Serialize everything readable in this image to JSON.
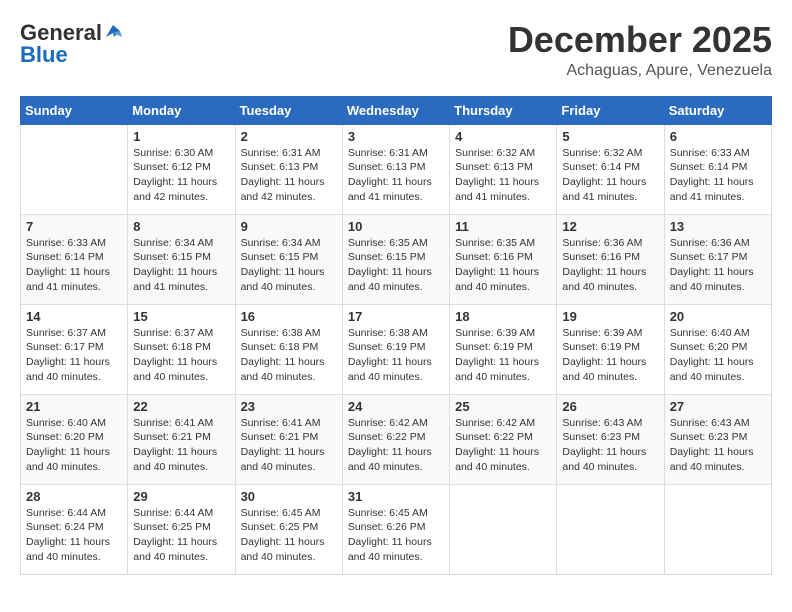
{
  "header": {
    "logo_general": "General",
    "logo_blue": "Blue",
    "title": "December 2025",
    "location": "Achaguas, Apure, Venezuela"
  },
  "calendar": {
    "days_of_week": [
      "Sunday",
      "Monday",
      "Tuesday",
      "Wednesday",
      "Thursday",
      "Friday",
      "Saturday"
    ],
    "weeks": [
      [
        {
          "day": "",
          "content": ""
        },
        {
          "day": "1",
          "content": "Sunrise: 6:30 AM\nSunset: 6:12 PM\nDaylight: 11 hours\nand 42 minutes."
        },
        {
          "day": "2",
          "content": "Sunrise: 6:31 AM\nSunset: 6:13 PM\nDaylight: 11 hours\nand 42 minutes."
        },
        {
          "day": "3",
          "content": "Sunrise: 6:31 AM\nSunset: 6:13 PM\nDaylight: 11 hours\nand 41 minutes."
        },
        {
          "day": "4",
          "content": "Sunrise: 6:32 AM\nSunset: 6:13 PM\nDaylight: 11 hours\nand 41 minutes."
        },
        {
          "day": "5",
          "content": "Sunrise: 6:32 AM\nSunset: 6:14 PM\nDaylight: 11 hours\nand 41 minutes."
        },
        {
          "day": "6",
          "content": "Sunrise: 6:33 AM\nSunset: 6:14 PM\nDaylight: 11 hours\nand 41 minutes."
        }
      ],
      [
        {
          "day": "7",
          "content": "Sunrise: 6:33 AM\nSunset: 6:14 PM\nDaylight: 11 hours\nand 41 minutes."
        },
        {
          "day": "8",
          "content": "Sunrise: 6:34 AM\nSunset: 6:15 PM\nDaylight: 11 hours\nand 41 minutes."
        },
        {
          "day": "9",
          "content": "Sunrise: 6:34 AM\nSunset: 6:15 PM\nDaylight: 11 hours\nand 40 minutes."
        },
        {
          "day": "10",
          "content": "Sunrise: 6:35 AM\nSunset: 6:15 PM\nDaylight: 11 hours\nand 40 minutes."
        },
        {
          "day": "11",
          "content": "Sunrise: 6:35 AM\nSunset: 6:16 PM\nDaylight: 11 hours\nand 40 minutes."
        },
        {
          "day": "12",
          "content": "Sunrise: 6:36 AM\nSunset: 6:16 PM\nDaylight: 11 hours\nand 40 minutes."
        },
        {
          "day": "13",
          "content": "Sunrise: 6:36 AM\nSunset: 6:17 PM\nDaylight: 11 hours\nand 40 minutes."
        }
      ],
      [
        {
          "day": "14",
          "content": "Sunrise: 6:37 AM\nSunset: 6:17 PM\nDaylight: 11 hours\nand 40 minutes."
        },
        {
          "day": "15",
          "content": "Sunrise: 6:37 AM\nSunset: 6:18 PM\nDaylight: 11 hours\nand 40 minutes."
        },
        {
          "day": "16",
          "content": "Sunrise: 6:38 AM\nSunset: 6:18 PM\nDaylight: 11 hours\nand 40 minutes."
        },
        {
          "day": "17",
          "content": "Sunrise: 6:38 AM\nSunset: 6:19 PM\nDaylight: 11 hours\nand 40 minutes."
        },
        {
          "day": "18",
          "content": "Sunrise: 6:39 AM\nSunset: 6:19 PM\nDaylight: 11 hours\nand 40 minutes."
        },
        {
          "day": "19",
          "content": "Sunrise: 6:39 AM\nSunset: 6:19 PM\nDaylight: 11 hours\nand 40 minutes."
        },
        {
          "day": "20",
          "content": "Sunrise: 6:40 AM\nSunset: 6:20 PM\nDaylight: 11 hours\nand 40 minutes."
        }
      ],
      [
        {
          "day": "21",
          "content": "Sunrise: 6:40 AM\nSunset: 6:20 PM\nDaylight: 11 hours\nand 40 minutes."
        },
        {
          "day": "22",
          "content": "Sunrise: 6:41 AM\nSunset: 6:21 PM\nDaylight: 11 hours\nand 40 minutes."
        },
        {
          "day": "23",
          "content": "Sunrise: 6:41 AM\nSunset: 6:21 PM\nDaylight: 11 hours\nand 40 minutes."
        },
        {
          "day": "24",
          "content": "Sunrise: 6:42 AM\nSunset: 6:22 PM\nDaylight: 11 hours\nand 40 minutes."
        },
        {
          "day": "25",
          "content": "Sunrise: 6:42 AM\nSunset: 6:22 PM\nDaylight: 11 hours\nand 40 minutes."
        },
        {
          "day": "26",
          "content": "Sunrise: 6:43 AM\nSunset: 6:23 PM\nDaylight: 11 hours\nand 40 minutes."
        },
        {
          "day": "27",
          "content": "Sunrise: 6:43 AM\nSunset: 6:23 PM\nDaylight: 11 hours\nand 40 minutes."
        }
      ],
      [
        {
          "day": "28",
          "content": "Sunrise: 6:44 AM\nSunset: 6:24 PM\nDaylight: 11 hours\nand 40 minutes."
        },
        {
          "day": "29",
          "content": "Sunrise: 6:44 AM\nSunset: 6:25 PM\nDaylight: 11 hours\nand 40 minutes."
        },
        {
          "day": "30",
          "content": "Sunrise: 6:45 AM\nSunset: 6:25 PM\nDaylight: 11 hours\nand 40 minutes."
        },
        {
          "day": "31",
          "content": "Sunrise: 6:45 AM\nSunset: 6:26 PM\nDaylight: 11 hours\nand 40 minutes."
        },
        {
          "day": "",
          "content": ""
        },
        {
          "day": "",
          "content": ""
        },
        {
          "day": "",
          "content": ""
        }
      ]
    ]
  }
}
